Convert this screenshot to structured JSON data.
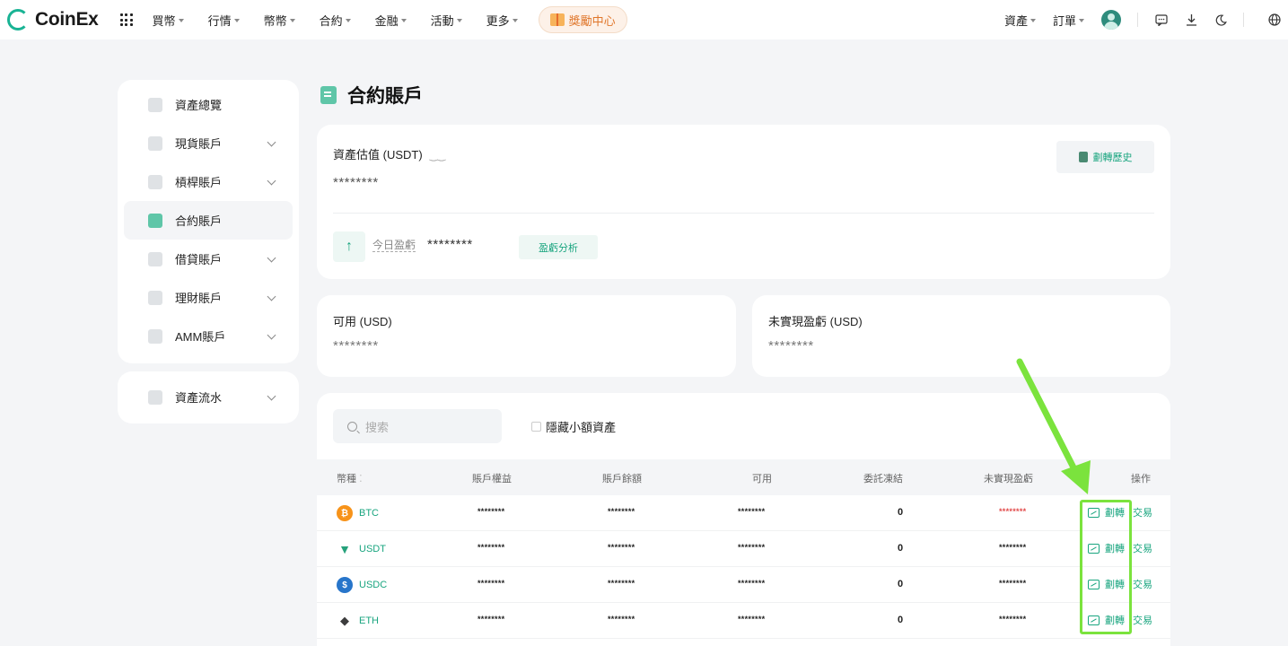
{
  "header": {
    "brand": "CoinEx",
    "nav": [
      "買幣",
      "行情",
      "幣幣",
      "合約",
      "金融",
      "活動",
      "更多"
    ],
    "reward_label": "獎勵中心",
    "right": {
      "assets": "資產",
      "orders": "訂單"
    },
    "icons": [
      "chat-icon",
      "download-icon",
      "moon-icon",
      "globe-icon"
    ]
  },
  "sidebar": {
    "items": [
      {
        "label": "資產總覽",
        "icon": "overview-icon",
        "expandable": false,
        "active": false
      },
      {
        "label": "現貨賬戶",
        "icon": "spot-icon",
        "expandable": true,
        "active": false
      },
      {
        "label": "槓桿賬戶",
        "icon": "margin-icon",
        "expandable": true,
        "active": false
      },
      {
        "label": "合約賬戶",
        "icon": "futures-icon",
        "expandable": false,
        "active": true
      },
      {
        "label": "借貸賬戶",
        "icon": "loan-icon",
        "expandable": true,
        "active": false
      },
      {
        "label": "理財賬戶",
        "icon": "finance-icon",
        "expandable": true,
        "active": false
      },
      {
        "label": "AMM賬戶",
        "icon": "amm-icon",
        "expandable": true,
        "active": false
      }
    ],
    "flow": {
      "label": "資產流水",
      "icon": "ledger-icon",
      "expandable": true
    }
  },
  "page": {
    "title": "合約賬戶",
    "estimate_label": "資產估值 (USDT)",
    "estimate_value": "********",
    "history_button": "劃轉歷史",
    "today_pnl_label": "今日盈虧",
    "today_pnl_value": "********",
    "analysis_button": "盈虧分析",
    "available_label": "可用 (USD)",
    "available_value": "********",
    "unrealized_label": "未實現盈虧 (USD)",
    "unrealized_value": "********"
  },
  "table": {
    "search_placeholder": "搜索",
    "hide_small_label": "隱藏小額資產",
    "headers": [
      "幣種",
      "賬戶權益",
      "賬戶餘額",
      "可用",
      "委託凍結",
      "未實現盈虧",
      "操作"
    ],
    "rows": [
      {
        "coin": "BTC",
        "icon_color": "#f7931a",
        "equity": "********",
        "balance": "********",
        "available": "********",
        "frozen": "0",
        "unrealized": "********",
        "unrealized_red": true
      },
      {
        "coin": "USDT",
        "icon_color": "#26a17b",
        "equity": "********",
        "balance": "********",
        "available": "********",
        "frozen": "0",
        "unrealized": "********",
        "unrealized_red": false
      },
      {
        "coin": "USDC",
        "icon_color": "#2775ca",
        "equity": "********",
        "balance": "********",
        "available": "********",
        "frozen": "0",
        "unrealized": "********",
        "unrealized_red": false
      },
      {
        "coin": "ETH",
        "icon_color": "#3c3c3d",
        "equity": "********",
        "balance": "********",
        "available": "********",
        "frozen": "0",
        "unrealized": "********",
        "unrealized_red": false
      }
    ],
    "op_transfer": "劃轉",
    "op_trade": "交易"
  },
  "colors": {
    "accent": "#19a57f",
    "annotation": "#7be33d",
    "loss": "#e24c4c"
  }
}
